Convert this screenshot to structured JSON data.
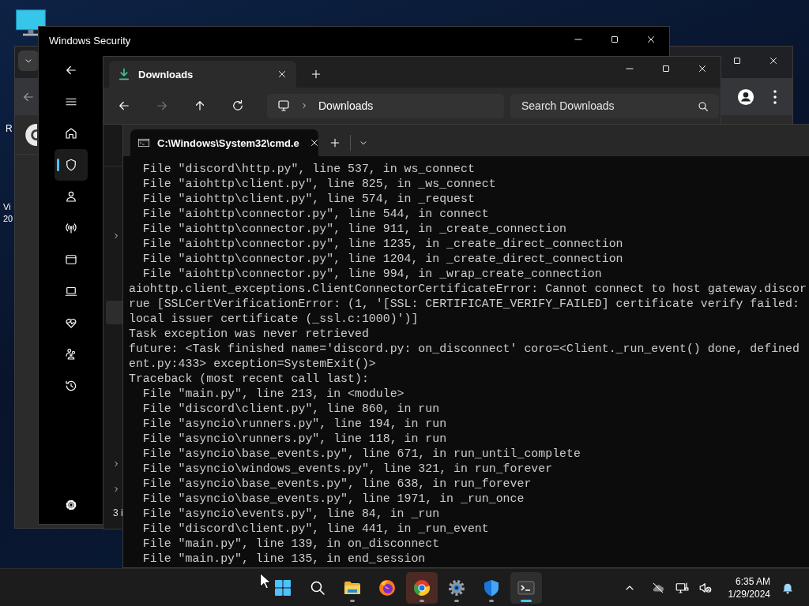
{
  "desktop": {
    "labels": [
      "R",
      "Vi",
      "20"
    ]
  },
  "security_window": {
    "title": "Windows Security",
    "nav": [
      {
        "selected": false
      },
      {
        "selected": true
      },
      {
        "selected": false
      },
      {
        "selected": false
      },
      {
        "selected": false
      },
      {
        "selected": false
      },
      {
        "selected": false
      },
      {
        "selected": false
      },
      {
        "selected": false
      },
      {
        "selected": false
      }
    ]
  },
  "explorer": {
    "tab": {
      "label": "Downloads"
    },
    "toolbar": [
      {
        "disabled": false
      },
      {
        "disabled": true
      },
      {
        "disabled": false
      },
      {
        "disabled": false
      }
    ],
    "address": "Downloads",
    "search": {
      "placeholder": "Search Downloads"
    },
    "nav_pane": [
      {
        "expandable": true,
        "selected": false
      },
      {
        "expandable": false,
        "selected": true
      },
      {
        "expandable": true,
        "selected": false
      },
      {
        "expandable": true,
        "selected": false
      }
    ],
    "status": "3 i"
  },
  "terminal": {
    "tab": {
      "title": "C:\\Windows\\System32\\cmd.e"
    },
    "lines": [
      "  File \"discord\\http.py\", line 537, in ws_connect",
      "  File \"aiohttp\\client.py\", line 825, in _ws_connect",
      "  File \"aiohttp\\client.py\", line 574, in _request",
      "  File \"aiohttp\\connector.py\", line 544, in connect",
      "  File \"aiohttp\\connector.py\", line 911, in _create_connection",
      "  File \"aiohttp\\connector.py\", line 1235, in _create_direct_connection",
      "  File \"aiohttp\\connector.py\", line 1204, in _create_direct_connection",
      "  File \"aiohttp\\connector.py\", line 994, in _wrap_create_connection",
      "aiohttp.client_exceptions.ClientConnectorCertificateError: Cannot connect to host gateway.discor",
      "rue [SSLCertVerificationError: (1, '[SSL: CERTIFICATE_VERIFY_FAILED] certificate verify failed:",
      "local issuer certificate (_ssl.c:1000)')]",
      "Task exception was never retrieved",
      "future: <Task finished name='discord.py: on_disconnect' coro=<Client._run_event() done, defined",
      "ent.py:433> exception=SystemExit()>",
      "Traceback (most recent call last):",
      "  File \"main.py\", line 213, in <module>",
      "  File \"discord\\client.py\", line 860, in run",
      "  File \"asyncio\\runners.py\", line 194, in run",
      "  File \"asyncio\\runners.py\", line 118, in run",
      "  File \"asyncio\\base_events.py\", line 671, in run_until_complete",
      "  File \"asyncio\\windows_events.py\", line 321, in run_forever",
      "  File \"asyncio\\base_events.py\", line 638, in run_forever",
      "  File \"asyncio\\base_events.py\", line 1971, in _run_once",
      "  File \"asyncio\\events.py\", line 84, in _run",
      "  File \"discord\\client.py\", line 441, in _run_event",
      "  File \"main.py\", line 139, in on_disconnect",
      "  File \"main.py\", line 135, in end_session"
    ]
  },
  "taskbar": {
    "apps": [
      {
        "running": false,
        "active": false,
        "flashing": false
      },
      {
        "running": false,
        "active": false,
        "flashing": false
      },
      {
        "running": true,
        "active": false,
        "flashing": false
      },
      {
        "running": false,
        "active": false,
        "flashing": false
      },
      {
        "running": true,
        "active": false,
        "flashing": true
      },
      {
        "running": true,
        "active": false,
        "flashing": false
      },
      {
        "running": true,
        "active": false,
        "flashing": false
      },
      {
        "running": true,
        "active": true,
        "flashing": false
      }
    ],
    "clock": {
      "time": "6:35 AM",
      "date": "1/29/2024"
    }
  }
}
